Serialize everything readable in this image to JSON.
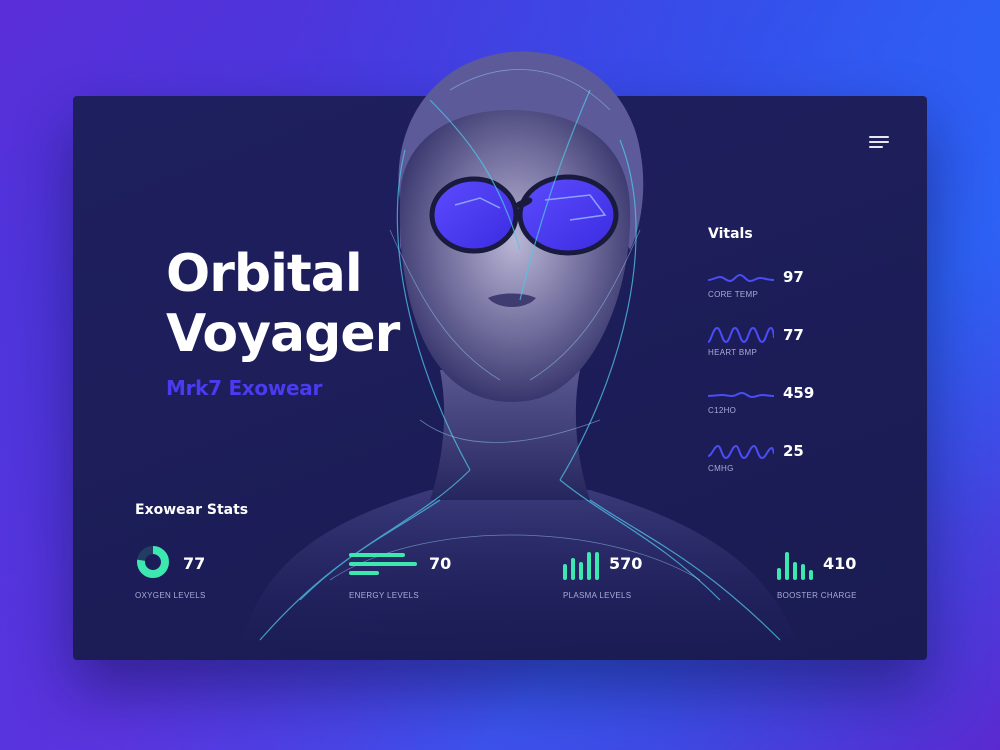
{
  "header": {
    "title_line1": "Orbital",
    "title_line2": "Voyager",
    "subtitle": "Mrk7 Exowear",
    "menu_icon": "hamburger-menu-icon"
  },
  "vitals": {
    "title": "Vitals",
    "items": [
      {
        "label": "CORE TEMP",
        "value": "97"
      },
      {
        "label": "HEART BMP",
        "value": "77"
      },
      {
        "label": "C12HO",
        "value": "459"
      },
      {
        "label": "CMHG",
        "value": "25"
      }
    ]
  },
  "stats": {
    "title": "Exowear Stats",
    "items": [
      {
        "label": "OXYGEN LEVELS",
        "value": "77",
        "icon": "donut-gauge-icon"
      },
      {
        "label": "ENERGY LEVELS",
        "value": "70",
        "icon": "horizontal-bars-icon"
      },
      {
        "label": "PLASMA LEVELS",
        "value": "570",
        "icon": "vertical-bars-icon"
      },
      {
        "label": "BOOSTER CHARGE",
        "value": "410",
        "icon": "vertical-bars-icon"
      }
    ]
  },
  "colors": {
    "accent_green": "#3de8b0",
    "accent_blue": "#4b3bf0",
    "wave_blue": "#4a4cf5",
    "card_bg": "#1e1f5e"
  }
}
